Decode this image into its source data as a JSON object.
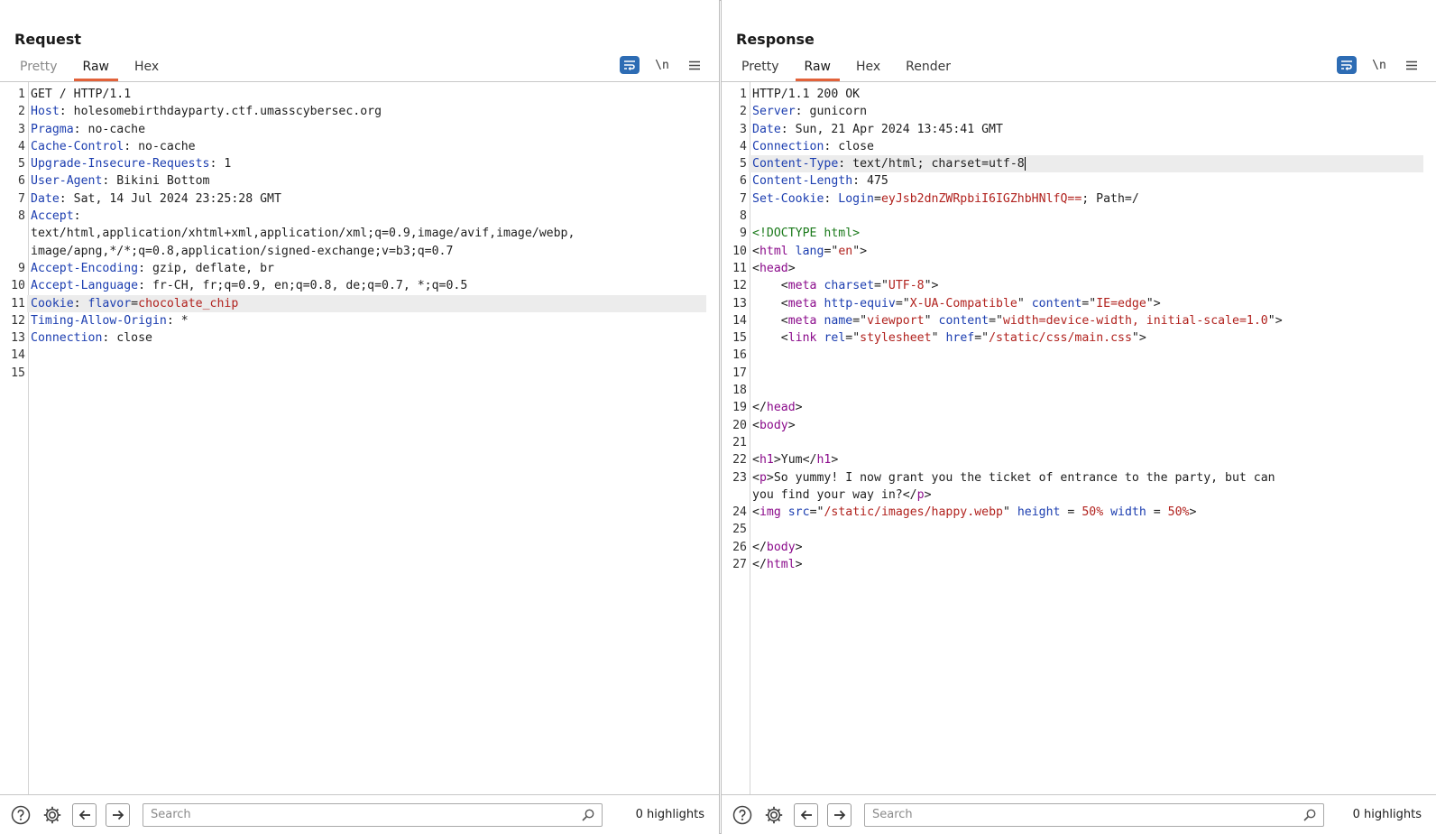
{
  "request": {
    "title": "Request",
    "tabs": [
      "Pretty",
      "Raw",
      "Hex"
    ],
    "active_tab": "Raw",
    "tools": {
      "newline_label": "\\n"
    },
    "search_placeholder": "Search",
    "highlights": "0 highlights",
    "lines": [
      {
        "n": "1",
        "html": "GET / HTTP/1.1"
      },
      {
        "n": "2",
        "html": "<span class=\"k\">Host</span>: holesomebirthdayparty.ctf.umasscybersec.org"
      },
      {
        "n": "3",
        "html": "<span class=\"k\">Pragma</span>: no-cache"
      },
      {
        "n": "4",
        "html": "<span class=\"k\">Cache-Control</span>: no-cache"
      },
      {
        "n": "5",
        "html": "<span class=\"k\">Upgrade-Insecure-Requests</span>: 1"
      },
      {
        "n": "6",
        "html": "<span class=\"k\">User-Agent</span>: Bikini Bottom"
      },
      {
        "n": "7",
        "html": "<span class=\"k\">Date</span>: Sat, 14 Jul 2024 23:25:28 GMT"
      },
      {
        "n": "8",
        "html": "<span class=\"k\">Accept</span>:<br>text/html,application/xhtml+xml,application/xml;q=0.9,image/avif,image/webp,<br>image/apng,*/*;q=0.8,application/signed-exchange;v=b3;q=0.7"
      },
      {
        "n": "9",
        "html": "<span class=\"k\">Accept-Encoding</span>: gzip, deflate, br"
      },
      {
        "n": "10",
        "html": "<span class=\"k\">Accept-Language</span>: fr-CH, fr;q=0.9, en;q=0.8, de;q=0.7, *;q=0.5"
      },
      {
        "n": "11",
        "html": "<span class=\"k\">Cookie</span>: <span class=\"k\">flavor</span>=<span class=\"v\">chocolate_chip</span>",
        "highlight": true
      },
      {
        "n": "12",
        "html": "<span class=\"k\">Timing-Allow-Origin</span>: *"
      },
      {
        "n": "13",
        "html": "<span class=\"k\">Connection</span>: close"
      },
      {
        "n": "14",
        "html": ""
      },
      {
        "n": "15",
        "html": ""
      }
    ]
  },
  "response": {
    "title": "Response",
    "tabs": [
      "Pretty",
      "Raw",
      "Hex",
      "Render"
    ],
    "active_tab": "Raw",
    "tools": {
      "newline_label": "\\n"
    },
    "search_placeholder": "Search",
    "highlights": "0 highlights",
    "lines": [
      {
        "n": "1",
        "html": "HTTP/1.1 200 OK"
      },
      {
        "n": "2",
        "html": "<span class=\"k\">Server</span>: gunicorn"
      },
      {
        "n": "3",
        "html": "<span class=\"k\">Date</span>: Sun, 21 Apr 2024 13:45:41 GMT"
      },
      {
        "n": "4",
        "html": "<span class=\"k\">Connection</span>: close"
      },
      {
        "n": "5",
        "html": "<span class=\"k\">Content-Type</span>: text/html; charset=utf-8<span class=\"caret\"></span>",
        "highlight": true
      },
      {
        "n": "6",
        "html": "<span class=\"k\">Content-Length</span>: 475"
      },
      {
        "n": "7",
        "html": "<span class=\"k\">Set-Cookie</span>: <span class=\"k\">Login</span>=<span class=\"v\">eyJsb2dnZWRpbiI6IGZhbHNlfQ==</span>; Path=/"
      },
      {
        "n": "8",
        "html": ""
      },
      {
        "n": "9",
        "html": "<span class=\"dt\">&lt;!DOCTYPE html&gt;</span>"
      },
      {
        "n": "10",
        "html": "&lt;<span class=\"t\">html</span> <span class=\"a\">lang</span>=\"<span class=\"v\">en</span>\"&gt;"
      },
      {
        "n": "11",
        "html": "&lt;<span class=\"t\">head</span>&gt;"
      },
      {
        "n": "12",
        "html": "    &lt;<span class=\"t\">meta</span> <span class=\"a\">charset</span>=\"<span class=\"v\">UTF-8</span>\"&gt;"
      },
      {
        "n": "13",
        "html": "    &lt;<span class=\"t\">meta</span> <span class=\"a\">http-equiv</span>=\"<span class=\"v\">X-UA-Compatible</span>\" <span class=\"a\">content</span>=\"<span class=\"v\">IE=edge</span>\"&gt;"
      },
      {
        "n": "14",
        "html": "    &lt;<span class=\"t\">meta</span> <span class=\"a\">name</span>=\"<span class=\"v\">viewport</span>\" <span class=\"a\">content</span>=\"<span class=\"v\">width=device-width, initial-scale=1.0</span>\"&gt;"
      },
      {
        "n": "15",
        "html": "    &lt;<span class=\"t\">link</span> <span class=\"a\">rel</span>=\"<span class=\"v\">stylesheet</span>\" <span class=\"a\">href</span>=\"<span class=\"v\">/static/css/main.css</span>\"&gt;"
      },
      {
        "n": "16",
        "html": ""
      },
      {
        "n": "17",
        "html": ""
      },
      {
        "n": "18",
        "html": ""
      },
      {
        "n": "19",
        "html": "&lt;/<span class=\"t\">head</span>&gt;"
      },
      {
        "n": "20",
        "html": "&lt;<span class=\"t\">body</span>&gt;"
      },
      {
        "n": "21",
        "html": ""
      },
      {
        "n": "22",
        "html": "&lt;<span class=\"t\">h1</span>&gt;Yum&lt;/<span class=\"t\">h1</span>&gt;"
      },
      {
        "n": "23",
        "html": "&lt;<span class=\"t\">p</span>&gt;So yummy! I now grant you the ticket of entrance to the party, but can<br>you find your way in?&lt;/<span class=\"t\">p</span>&gt;"
      },
      {
        "n": "24",
        "html": "&lt;<span class=\"t\">img</span> <span class=\"a\">src</span>=\"<span class=\"v\">/static/images/happy.webp</span>\" <span class=\"a\">height</span> = <span class=\"v\">50%</span> <span class=\"a\">width</span> = <span class=\"v\">50%</span>&gt;"
      },
      {
        "n": "25",
        "html": ""
      },
      {
        "n": "26",
        "html": "&lt;/<span class=\"t\">body</span>&gt;"
      },
      {
        "n": "27",
        "html": "&lt;/<span class=\"t\">html</span>&gt;"
      }
    ]
  },
  "colors": {
    "accent": "#e2623a",
    "primary_button": "#2d6cb4",
    "header_key": "#1c3eb0",
    "value": "#b1221e",
    "tag": "#8b0b8b"
  },
  "icons": [
    "help-icon",
    "settings-icon",
    "back-arrow-icon",
    "forward-arrow-icon",
    "search-icon",
    "wrap-icon",
    "menu-icon"
  ]
}
